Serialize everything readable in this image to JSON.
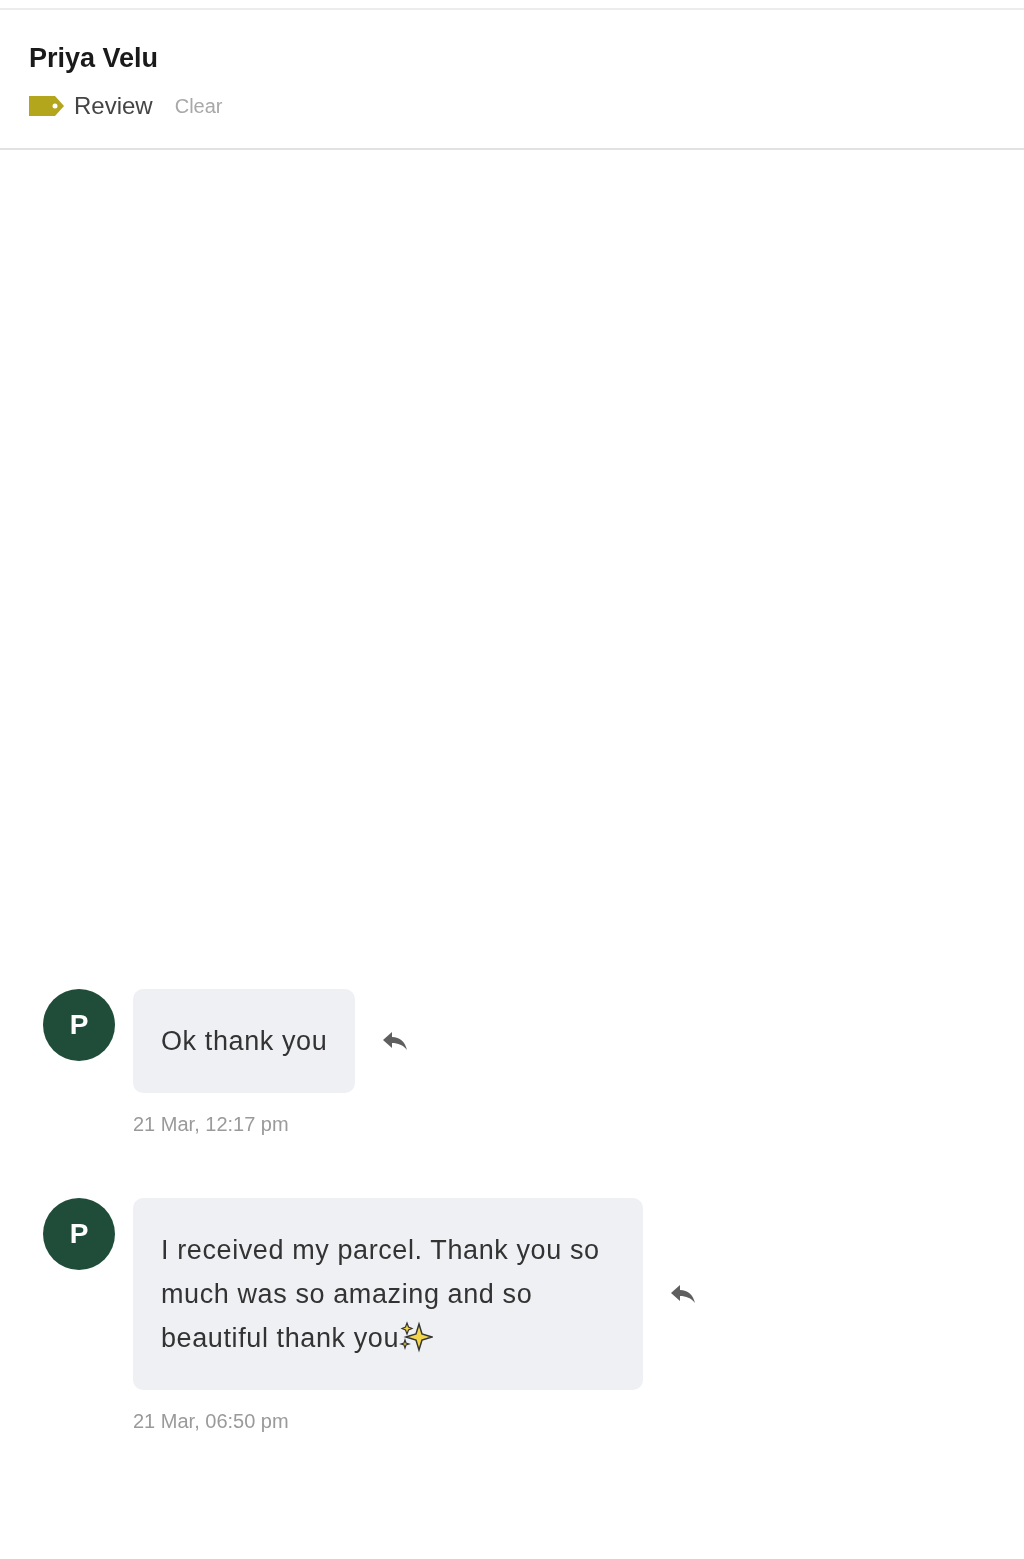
{
  "contact": {
    "name": "Priya Velu",
    "label": {
      "text": "Review",
      "color": "#b3a51c"
    },
    "clear": "Clear"
  },
  "messages": [
    {
      "avatar": "P",
      "text": "Ok thank you",
      "sparkle": false,
      "time": "21 Mar, 12:17 pm"
    },
    {
      "avatar": "P",
      "text": "I received my parcel. Thank you so much was so amazing and so beautiful thank you",
      "sparkle": true,
      "time": "21 Mar, 06:50 pm"
    }
  ]
}
